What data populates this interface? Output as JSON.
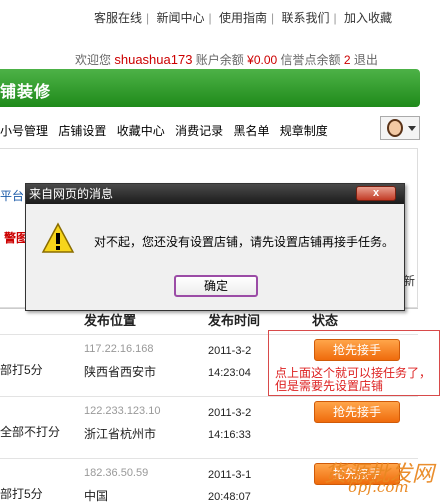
{
  "topnav": {
    "items": [
      "客服在线",
      "新闻中心",
      "使用指南",
      "联系我们",
      "加入收藏"
    ],
    "sep": "|"
  },
  "userbar": {
    "welcome": "欢迎您",
    "username": "shuashua173",
    "balance_label": "账户余额",
    "balance": "¥0.00",
    "credit_label": "信誉点余额",
    "credit": "2",
    "logout": "退出"
  },
  "header": {
    "title": "铺装修"
  },
  "menu": {
    "items": [
      "小号管理",
      "店铺设置",
      "收藏中心",
      "消费记录",
      "黑名单",
      "规章制度"
    ]
  },
  "background_fragments": {
    "left1": "平台",
    "left2": "警图",
    "right": "新"
  },
  "table": {
    "headers": [
      "发布位置",
      "发布时间",
      "状态"
    ],
    "rows": [
      {
        "c1": "部打5分",
        "ip": "117.22.16.168",
        "location": "陕西省西安市",
        "date": "2011-3-2",
        "time": "14:23:04",
        "button": "抢先接手"
      },
      {
        "c1": "全部不打分",
        "ip": "122.233.123.10",
        "location": "浙江省杭州市",
        "date": "2011-3-2",
        "time": "14:16:33",
        "button": "抢先接手"
      },
      {
        "c1": "部打5分",
        "ip": "182.36.50.59",
        "location": "中国",
        "date": "2011-3-1",
        "time": "20:48:07",
        "button": "抢先接手"
      }
    ]
  },
  "annotation": {
    "line1": "点上面这个就可以接任务了，",
    "line2": "但是需要先设置店铺"
  },
  "dialog": {
    "title": "来自网页的消息",
    "close": "x",
    "message": "对不起，您还没有设置店铺，请先设置店铺再接手任务。",
    "ok": "确定"
  },
  "watermark": {
    "text": "货源批发网",
    "sub": "6pf.com"
  },
  "colors": {
    "brand_green": "#2a9a24",
    "accent_orange": "#f27a1a",
    "alert_red": "#cc0000"
  },
  "icons": {
    "warning": "warning-icon",
    "avatar": "avatar-icon",
    "close": "close-icon"
  }
}
